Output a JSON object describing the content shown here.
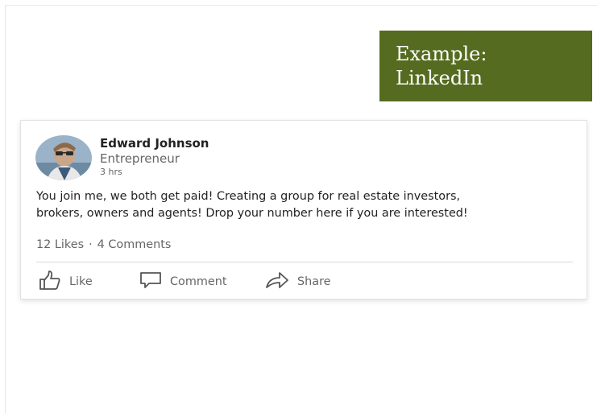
{
  "example_label": "Example:\nLinkedIn",
  "post": {
    "author_name": "Edward Johnson",
    "author_title": "Entrepreneur",
    "time": "3 hrs",
    "text_lines": [
      "You join me, we both get paid!  Creating a group for real estate investors,",
      "brokers, owners and agents!  Drop your number here if you are interested!"
    ],
    "likes": "12 Likes",
    "separator": "·",
    "comments": "4 Comments",
    "actions": {
      "like": "Like",
      "comment": "Comment",
      "share": "Share"
    }
  },
  "colors": {
    "label_bg": "#556b1f",
    "text_primary": "#222222",
    "text_secondary": "#666666"
  },
  "icons": [
    "thumbs-up-icon",
    "comment-icon",
    "share-icon"
  ]
}
